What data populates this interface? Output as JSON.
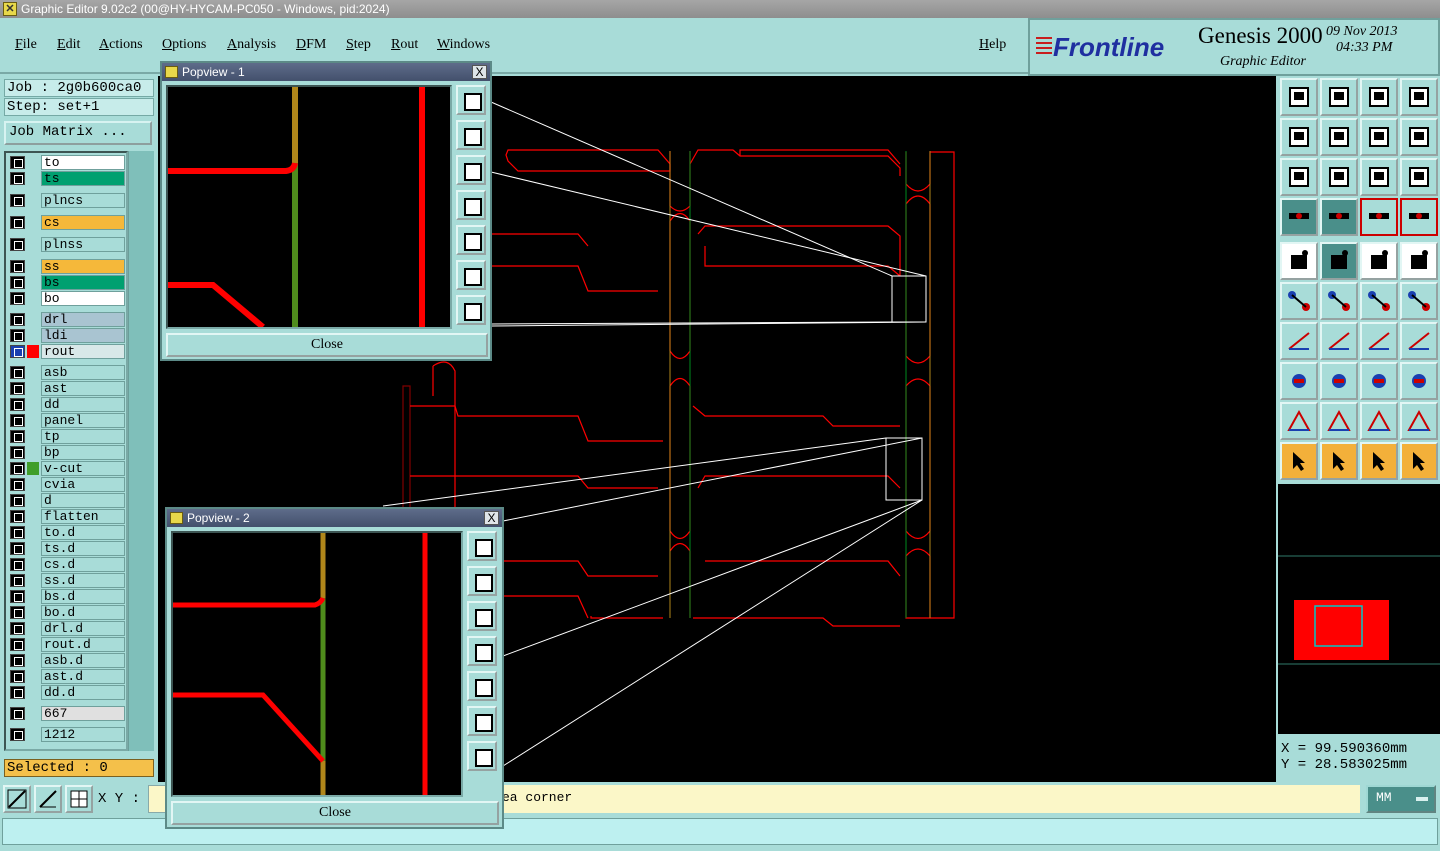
{
  "window": {
    "title": "Graphic Editor 9.02c2 (00@HY-HYCAM-PC050 - Windows, pid:2024)"
  },
  "menu": {
    "file": "File",
    "edit": "Edit",
    "actions": "Actions",
    "options": "Options",
    "analysis": "Analysis",
    "dfm": "DFM",
    "step": "Step",
    "rout": "Rout",
    "windows": "Windows",
    "help": "Help"
  },
  "brand": {
    "logo": "Frontline",
    "product": "Genesis 2000",
    "subtitle": "Graphic Editor",
    "date": "09 Nov 2013",
    "time": "04:33 PM"
  },
  "job": {
    "job_line": "Job : 2g0b600ca0",
    "step_line": "Step: set+1",
    "matrix_button": "Job Matrix ..."
  },
  "layers": [
    {
      "name": "to",
      "color": "#ffffff"
    },
    {
      "name": "ts",
      "color": "#00a070"
    },
    {
      "name": "plncs",
      "color": "#a8dcd8"
    },
    {
      "name": "cs",
      "color": "#f5b83a"
    },
    {
      "name": "plnss",
      "color": "#a8dcd8"
    },
    {
      "name": "ss",
      "color": "#f5b83a"
    },
    {
      "name": "bs",
      "color": "#00a070"
    },
    {
      "name": "bo",
      "color": "#ffffff"
    },
    {
      "name": "drl",
      "color": "#a9c4d1"
    },
    {
      "name": "ldi",
      "color": "#a9c4d1"
    },
    {
      "name": "rout",
      "color": "#d8e8e8",
      "active": true
    },
    {
      "name": "asb",
      "color": "#a8dcd8"
    },
    {
      "name": "ast",
      "color": "#a8dcd8"
    },
    {
      "name": "dd",
      "color": "#a8dcd8"
    },
    {
      "name": "panel",
      "color": "#a8dcd8"
    },
    {
      "name": "tp",
      "color": "#a8dcd8"
    },
    {
      "name": "bp",
      "color": "#a8dcd8"
    },
    {
      "name": "v-cut",
      "color": "#a8dcd8",
      "affected": true
    },
    {
      "name": "cvia",
      "color": "#a8dcd8"
    },
    {
      "name": "d",
      "color": "#a8dcd8"
    },
    {
      "name": "flatten",
      "color": "#a8dcd8"
    },
    {
      "name": "to.d",
      "color": "#a8dcd8"
    },
    {
      "name": "ts.d",
      "color": "#a8dcd8"
    },
    {
      "name": "cs.d",
      "color": "#a8dcd8"
    },
    {
      "name": "ss.d",
      "color": "#a8dcd8"
    },
    {
      "name": "bs.d",
      "color": "#a8dcd8"
    },
    {
      "name": "bo.d",
      "color": "#a8dcd8"
    },
    {
      "name": "drl.d",
      "color": "#a8dcd8"
    },
    {
      "name": "rout.d",
      "color": "#a8dcd8"
    },
    {
      "name": "asb.d",
      "color": "#a8dcd8"
    },
    {
      "name": "ast.d",
      "color": "#a8dcd8"
    },
    {
      "name": "dd.d",
      "color": "#a8dcd8"
    },
    {
      "name": "667",
      "color": "#e0e0e0"
    },
    {
      "name": "1212",
      "color": "#a8dcd8"
    }
  ],
  "selected": "Selected : 0",
  "popview1": {
    "title": "Popview - 1",
    "close": "Close"
  },
  "popview2": {
    "title": "Popview - 2",
    "close": "Close"
  },
  "popview_close_glyph": "X",
  "coords": {
    "x": "X = 99.590360mm",
    "y": "Y = 28.583025mm"
  },
  "bottom": {
    "xy_label": "X Y :",
    "message": "ea corner",
    "units": "MM"
  },
  "colors": {
    "panel": "#a8dcd8",
    "canvas": "#000000",
    "rout": "#ff0000",
    "vcut": "#008a1e",
    "cs_layer": "#b0861a",
    "highlight": "#f5b83a"
  },
  "icons": [
    "home-icon",
    "zoom-fit-icon",
    "zoom-in-icon",
    "zoom-out-icon",
    "measure-icon",
    "select-arrow-icon",
    "snap-icon"
  ]
}
